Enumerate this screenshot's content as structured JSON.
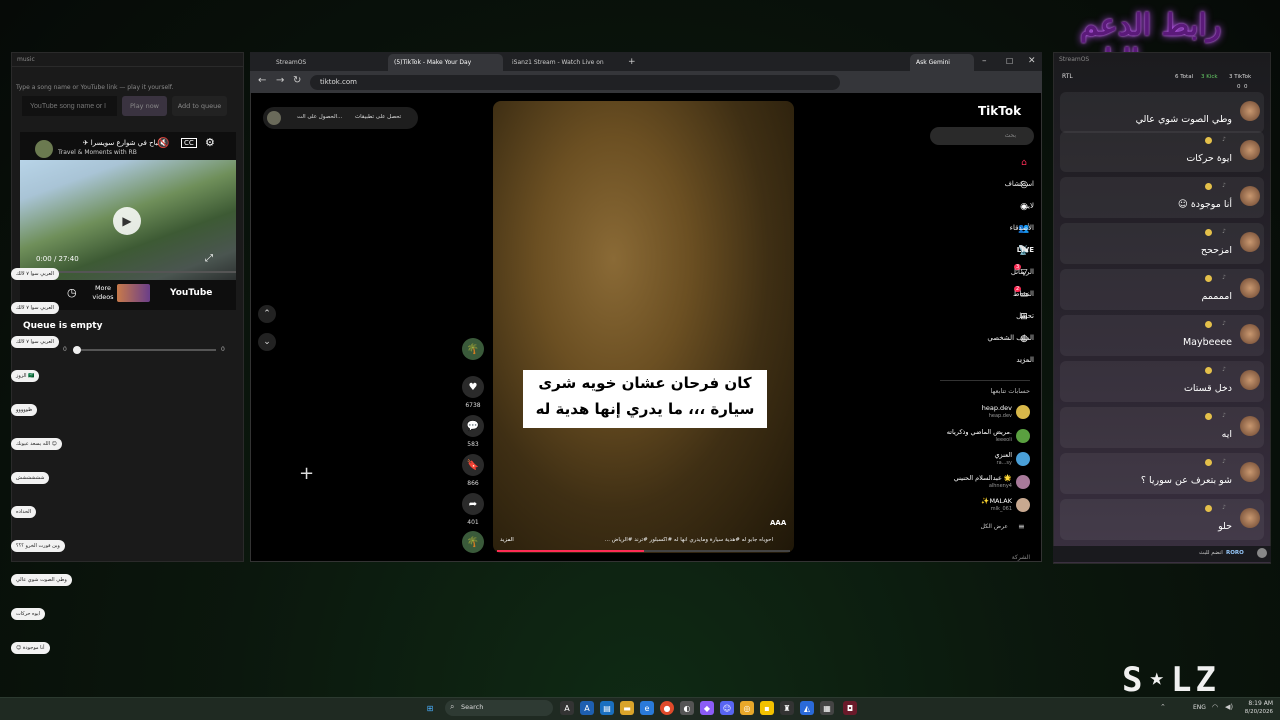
{
  "banner": "رابط الدعم بالبايو",
  "left": {
    "title": "music",
    "hint": "Type a song name or YouTube link — play it yourself.",
    "placeholder": "YouTube song name or l",
    "play": "Play now",
    "queue": "Add to queue",
    "yt_title": "الصباح في شوارع سويسرا ✈",
    "yt_channel": "Travel & Moments with RB",
    "time": "0:00 / 27:40",
    "more": "More videos",
    "ytlogo": "YouTube",
    "queue_empty": "Queue is empty",
    "vol_left": "0",
    "vol_right": "0",
    "chat_items": [
      "العربي سوا ٧ لالك",
      "العربي سوا ٧ لالك",
      "العربي سوا ٧ لالك",
      "الزوز 🇸🇦",
      "ظووووو",
      "الله يسعد عيونك ☺",
      "شششششش",
      "الحداده",
      "وين فورت الخرو ؟؟؟",
      "وطي الصوت شوي عالي",
      "ايوه حركات",
      "☺ أنا موجودة"
    ]
  },
  "browser": {
    "tabs": [
      "StreamOS",
      "(5)TikTok - Make Your Day",
      "iSanz1 Stream - Watch Live on"
    ],
    "ask": "Ask Gemini",
    "url": "tiktok.com",
    "getapp": "تحصل على تطبيقات",
    "coin": "الحصول على الت...",
    "caption_l1": "كان فرحان عشان خويه شرى",
    "caption_l2": "سيارة ،،، ما يدري إنها هدية له",
    "aaa": "AAA",
    "desc": "احوياه جابو له #هدية سيارة ومايدري انها له #اكسبلور #ترند #الرياض ...",
    "more": "المزيد",
    "likes": "6738",
    "comments": "583",
    "saves": "866",
    "shares": "401"
  },
  "tiktok": {
    "logo": "TikTok",
    "search": "بحث",
    "nav": [
      "",
      "استكشاف",
      "لايف",
      "الأصدقاء",
      "LIVE",
      "الرسائل",
      "النشاط",
      "تحميل",
      "الملف الشخصي",
      "المزيد"
    ],
    "badge_msg": "3",
    "badge_act": "2",
    "following_title": "حسابات تتابعها",
    "following": [
      {
        "n": "heap.dev",
        "h": "heap.dev"
      },
      {
        "n": "مريض الماضي وذكرياته.",
        "h": "leeeoli"
      },
      {
        "n": "العنزي",
        "h": "ra...sy"
      },
      {
        "n": "عبدالسلام الحنيني 🌟",
        "h": "alhneny4"
      },
      {
        "n": "✨MALAK",
        "h": "mlk_061"
      }
    ],
    "see_all": "عرض الكل",
    "company": "الشركة"
  },
  "right": {
    "title": "StreamOS",
    "rtl": "RTL",
    "total": "6 Total",
    "kick": "3 Kick",
    "tt": "3 TikTok",
    "counts": "0  0",
    "msgs": [
      "وطي الصوت شوي عالي",
      "ايوة حركات",
      "أنا موجودة ☺",
      "امزححح",
      "اممممم",
      "Maybeeee",
      "دخل قستات",
      "ايه",
      "شو بتعرف عن سوريا ؟",
      "حلو"
    ],
    "joined_name": "RORO",
    "joined": "انضم للبث"
  },
  "taskbar": {
    "search": "Search",
    "lang": "ENG",
    "time": "8:19 AM",
    "date": "8/20/2026"
  },
  "logo": "S⋆LZ"
}
